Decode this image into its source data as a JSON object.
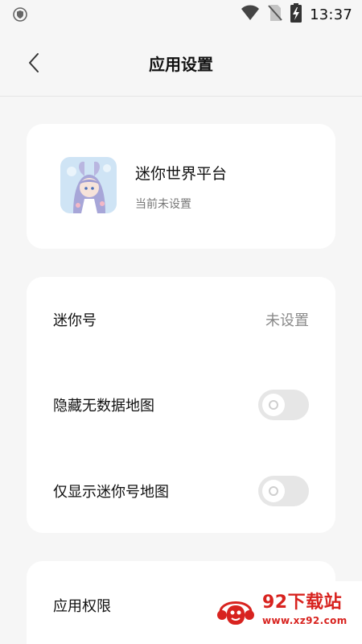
{
  "status_bar": {
    "time": "13:37",
    "icons": [
      "shield-icon",
      "wifi-icon",
      "no-sim-icon",
      "battery-charging-icon"
    ]
  },
  "header": {
    "title": "应用设置",
    "back_icon": "chevron-left-icon"
  },
  "app_card": {
    "name": "迷你世界平台",
    "status": "当前未设置",
    "icon": "app-icon"
  },
  "settings": {
    "mini_id": {
      "label": "迷你号",
      "value": "未设置"
    },
    "hide_empty_maps": {
      "label": "隐藏无数据地图",
      "enabled": false
    },
    "show_mini_maps_only": {
      "label": "仅显示迷你号地图",
      "enabled": false
    }
  },
  "permissions": {
    "label": "应用权限"
  },
  "watermark": {
    "title": "92下载站",
    "url": "www.xz92.com"
  },
  "colors": {
    "background": "#f6f6f6",
    "card": "#ffffff",
    "toggle_off": "#e6e6e6",
    "watermark_red": "#d8231f"
  }
}
